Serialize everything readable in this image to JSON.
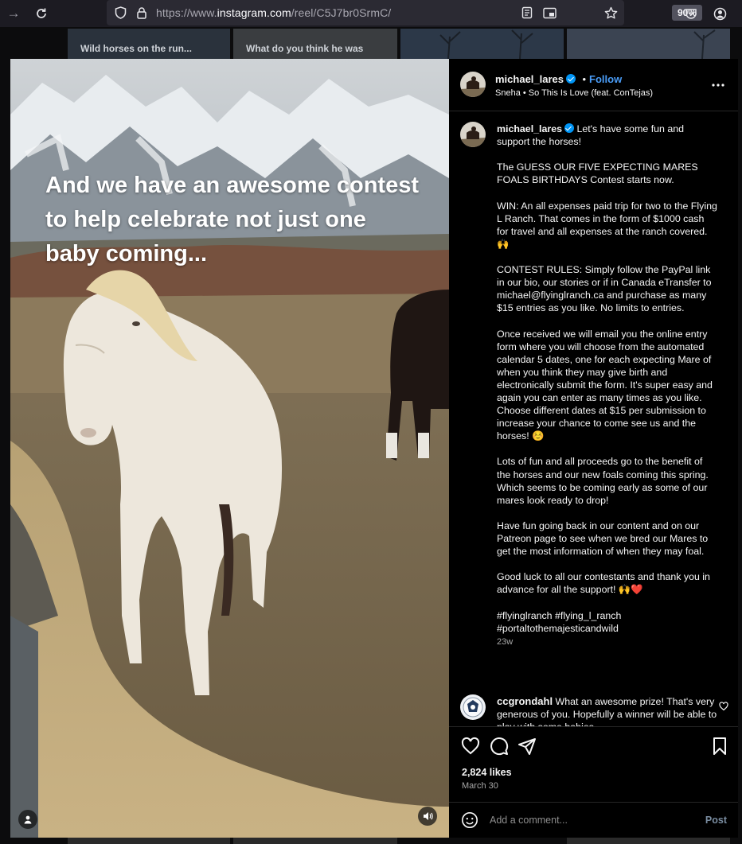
{
  "browser": {
    "url_prefix": "https://www.",
    "url_domain": "instagram.com",
    "url_path": "/reel/C5J7br0SrmC/",
    "zoom": "90%"
  },
  "background_thumbs": [
    {
      "text": "Wild horses on the run..."
    },
    {
      "text": "What do you think he was"
    },
    {
      "text": ""
    },
    {
      "text": ""
    }
  ],
  "video": {
    "overlay_text": "And we have an awesome contest to help celebrate not just one baby coming..."
  },
  "post": {
    "author": "michael_lares",
    "follow_label": "Follow",
    "audio": "Sneha • So This Is Love (feat. ConTejas)",
    "caption_user": "michael_lares",
    "caption_text": "Let's have some fun and support the horses!\n\nThe GUESS OUR FIVE EXPECTING MARES FOALS BIRTHDAYS Contest starts now.\n\nWIN: An all expenses paid trip for two to the Flying L Ranch. That comes in the form of $1000 cash for travel and all expenses at the ranch covered. 🙌\n\nCONTEST RULES: Simply follow the PayPal link in our bio, our stories or if in Canada eTransfer to michael@flyinglranch.ca and purchase as many $15 entries as you like. No limits to entries.\n\nOnce received we will email you the online entry form where you will choose from the automated calendar 5 dates, one for each expecting Mare of when you think they may give birth and electronically submit the form. It's super easy and again you can enter as many times as you like. Choose different dates at $15 per submission to increase your chance to come see us and the horses! ☺️\n\nLots of fun and all proceeds go to the benefit of the horses and our new foals coming this spring. Which seems to be coming early as some of our mares look ready to drop!\n\nHave fun going back in our content and on our Patreon page to see when we bred our Mares to get the most information of when they may foal.\n\nGood luck to all our contestants and thank you in advance for all the support! 🙌❤️\n\n#flyinglranch #flying_l_ranch #portaltothemajesticandwild",
    "caption_time": "23w",
    "comment_user": "ccgrondahl",
    "comment_text": "What an awesome prize! That's very generous of you. Hopefully a winner will be able to play with some babies",
    "likes": "2,824 likes",
    "date": "March 30",
    "comment_placeholder": "Add a comment...",
    "post_label": "Post"
  },
  "icons": {
    "back": "arrow-right-icon",
    "reload": "reload-icon",
    "shield": "shield-icon",
    "lock": "lock-icon",
    "reader": "reader-view-icon",
    "pip": "picture-in-picture-icon",
    "bookmark_star": "star-icon",
    "pocket": "pocket-icon",
    "account": "account-icon",
    "more": "more-options-icon",
    "like": "heart-icon",
    "comment": "comment-icon",
    "share": "share-icon",
    "save": "bookmark-icon",
    "emoji": "emoji-icon",
    "audio_toggle": "speaker-icon",
    "tag_user": "user-tag-icon"
  },
  "colors": {
    "accent": "#0095f6",
    "follow": "#4a9df8",
    "panel_bg": "#000000"
  }
}
